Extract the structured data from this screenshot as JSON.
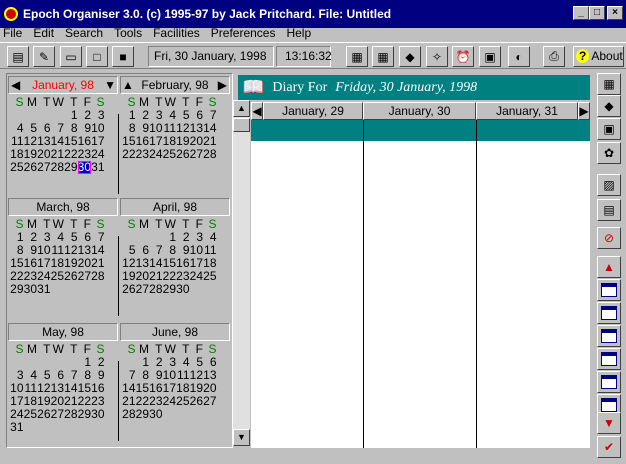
{
  "window": {
    "title": "Epoch Organiser 3.0.  (c) 1995-97 by Jack Pritchard.  File: Untitled"
  },
  "menu": [
    "File",
    "Edit",
    "Search",
    "Tools",
    "Facilities",
    "Preferences",
    "Help"
  ],
  "toolbar": {
    "date": "Fri, 30 January, 1998",
    "time": "13:16:32",
    "about": "About"
  },
  "colors": {
    "title": "#000080",
    "teal": "#008080",
    "weekend": "#008000",
    "selected": "#0000c0",
    "month_active": "#ff0000"
  },
  "calendar": {
    "weekday_headers": [
      "S",
      "M",
      "T",
      "W",
      "T",
      "F",
      "S"
    ],
    "months": [
      {
        "name": "January, 98",
        "active": true,
        "start": 4,
        "days": 31,
        "selected": 30
      },
      {
        "name": "February, 98",
        "active": false,
        "start": 0,
        "days": 28
      },
      {
        "name": "March, 98",
        "active": false,
        "start": 0,
        "days": 31
      },
      {
        "name": "April, 98",
        "active": false,
        "start": 3,
        "days": 30
      },
      {
        "name": "May, 98",
        "active": false,
        "start": 5,
        "days": 31
      },
      {
        "name": "June, 98",
        "active": false,
        "start": 1,
        "days": 30
      }
    ]
  },
  "diary": {
    "label": "Diary For",
    "date": "Friday, 30 January, 1998",
    "columns": [
      "January, 29",
      "January, 30",
      "January, 31"
    ]
  },
  "icons": [
    "new-document-icon",
    "open-icon",
    "folder-icon",
    "blank-page-icon",
    "save-icon",
    "printer-diary-icon",
    "calendar-icon",
    "eraser-icon",
    "find-icon",
    "alarm-clock-icon",
    "notes-icon",
    "projector-icon",
    "print-icon",
    "help-icon"
  ],
  "right_toolbar": [
    "calendar-icon",
    "eraser-icon",
    "tasks-icon",
    "people-icon",
    "chart-icon",
    "year-calendar-icon",
    "cancel-icon",
    "up-arrow-icon",
    "day-1-icon",
    "day-2-icon",
    "day-3-icon",
    "day-4-icon",
    "day-5-icon",
    "day-6-icon",
    "down-arrow-icon",
    "check-icon"
  ]
}
